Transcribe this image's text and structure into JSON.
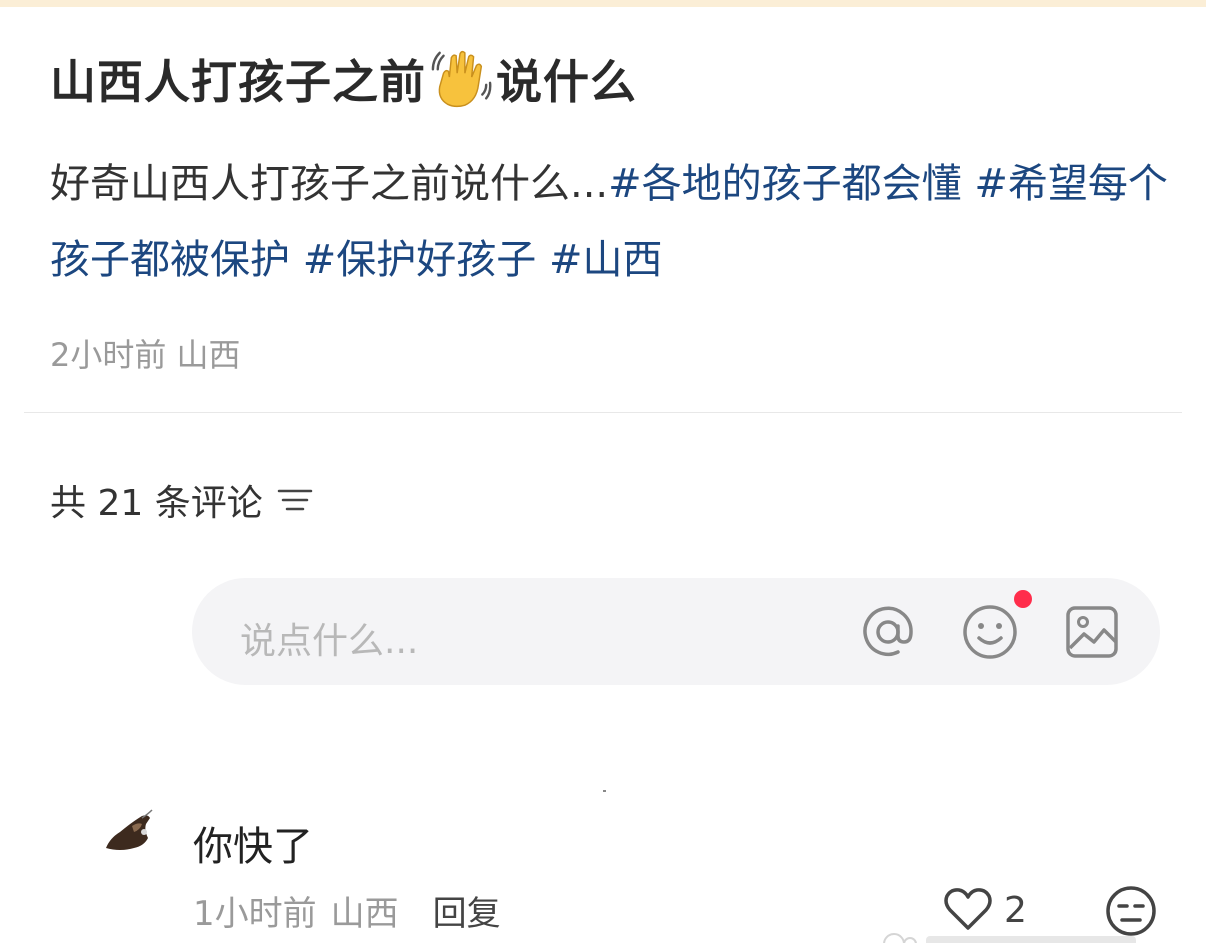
{
  "post": {
    "title_before": "山西人打孩子之前",
    "title_emoji": "waving-hand-icon",
    "title_after": "说什么",
    "body_text": "好奇山西人打孩子之前说什么...",
    "tags": [
      "#各地的孩子都会懂 ",
      "#希望每个孩子都被保护 ",
      "#保护好孩子 ",
      "#山西"
    ],
    "time": "2小时前",
    "location": "山西"
  },
  "comments_section": {
    "count_label": "共 21 条评论",
    "sort_icon": "sort-icon",
    "input": {
      "placeholder": "说点什么...",
      "icons": [
        "at-icon",
        "emoji-icon",
        "image-icon"
      ]
    }
  },
  "comments": [
    {
      "text": "你快了",
      "time": "1小时前",
      "location": "山西",
      "reply_label": "回复",
      "likes": "2",
      "like_icon": "heart-icon",
      "dislike_icon": "dislike-face-icon"
    }
  ],
  "colors": {
    "tag": "#1c4780",
    "meta": "#9a9a9a",
    "notification_dot": "#ff2d4b",
    "input_bg": "#f4f4f6",
    "top_strip": "#fbeed6"
  }
}
